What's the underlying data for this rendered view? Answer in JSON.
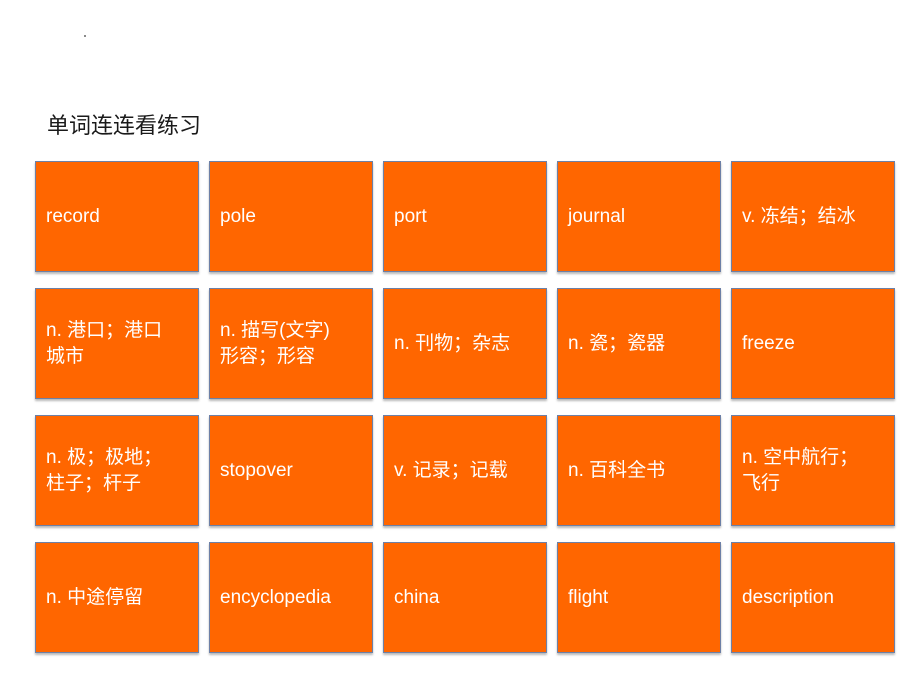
{
  "slide": {
    "title": "单词连连看练习",
    "accent_color": "#ff6600",
    "cells": [
      {
        "text": "record"
      },
      {
        "text": "pole"
      },
      {
        "text": "port"
      },
      {
        "text": "journal"
      },
      {
        "text": "v. 冻结；结冰"
      },
      {
        "text": "n. 港口；港口\n城市"
      },
      {
        "text": "n. 描写(文字)\n形容；形容"
      },
      {
        "text": "n. 刊物；杂志"
      },
      {
        "text": "n. 瓷；瓷器"
      },
      {
        "text": "freeze"
      },
      {
        "text": "n. 极；极地；\n柱子；杆子"
      },
      {
        "text": "stopover"
      },
      {
        "text": "v. 记录；记载"
      },
      {
        "text": "n. 百科全书"
      },
      {
        "text": "n. 空中航行；\n飞行"
      },
      {
        "text": "n. 中途停留"
      },
      {
        "text": "encyclopedia"
      },
      {
        "text": "china"
      },
      {
        "text": "flight"
      },
      {
        "text": "description"
      }
    ]
  }
}
